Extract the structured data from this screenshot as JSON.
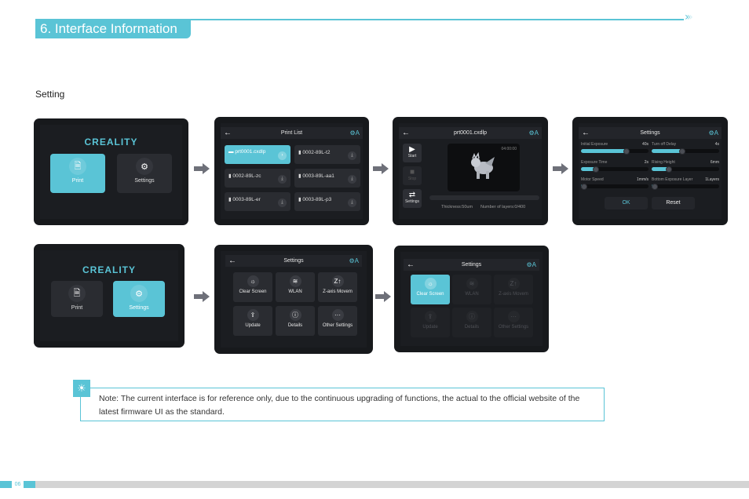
{
  "header": {
    "title": "6. Interface Information",
    "chevrons": [
      "›",
      "›",
      "›"
    ]
  },
  "section_label": "Setting",
  "brand": "CREALITY",
  "home_screen_print": {
    "buttons": [
      {
        "label": "Print",
        "icon": "file-icon",
        "glyph": "🗎",
        "active": true
      },
      {
        "label": "Settings",
        "icon": "gear-icon",
        "glyph": "⚙",
        "active": false
      }
    ]
  },
  "print_list": {
    "title": "Print List",
    "back_glyph": "←",
    "lang_glyph": "⚙A",
    "files": [
      {
        "name": "prt0001.cxdlp",
        "action": "›",
        "active": true
      },
      {
        "name": "0002-89L-t2",
        "action": "⤓",
        "active": false
      },
      {
        "name": "0002-89L-zc",
        "action": "⤓",
        "active": false
      },
      {
        "name": "0003-89L-aa1",
        "action": "⤓",
        "active": false
      },
      {
        "name": "0003-89L-er",
        "action": "⤓",
        "active": false
      },
      {
        "name": "0003-89L-p3",
        "action": "⤓",
        "active": false
      }
    ],
    "folder_glyph": "▬",
    "usb_glyph": "▮"
  },
  "print_detail": {
    "title": "prt0001.cxdlp",
    "time": "04:00:00",
    "buttons": [
      {
        "label": "Start",
        "glyph": "▶",
        "dim": false
      },
      {
        "label": "Stop",
        "glyph": "■",
        "dim": true
      },
      {
        "label": "Settings",
        "glyph": "⇄",
        "dim": false
      }
    ],
    "thickness": "Thickness:50um",
    "layers": "Number of layers:0/400",
    "progress": 0
  },
  "print_settings": {
    "title": "Settings",
    "sliders": [
      {
        "label": "Initial Exposure",
        "value": "40s",
        "fraction": 0.68
      },
      {
        "label": "Turn off Delay",
        "value": "4s",
        "fraction": 0.45
      },
      {
        "label": "Exposure Time",
        "value": "2s",
        "fraction": 0.22
      },
      {
        "label": "Rising Height",
        "value": "6mm",
        "fraction": 0.25
      },
      {
        "label": "Motor Speed",
        "value": "1mm/s",
        "fraction": 0.05
      },
      {
        "label": "Bottom Exposure Layer",
        "value": "1Layers",
        "fraction": 0.05
      }
    ],
    "ok_label": "OK",
    "reset_label": "Reset"
  },
  "home_screen_settings": {
    "buttons": [
      {
        "label": "Print",
        "glyph": "🗎",
        "active": false
      },
      {
        "label": "Settings",
        "glyph": "⚙",
        "active": true
      }
    ]
  },
  "settings_menu": {
    "title": "Settings",
    "tiles": [
      {
        "label": "Clear Screen",
        "glyph": "☼"
      },
      {
        "label": "WLAN",
        "glyph": "≋"
      },
      {
        "label": "Z-axis Movem",
        "glyph": "Z↑"
      },
      {
        "label": "Update",
        "glyph": "⇪"
      },
      {
        "label": "Details",
        "glyph": "ⓘ"
      },
      {
        "label": "Other Settings",
        "glyph": "···"
      }
    ]
  },
  "settings_menu_selected": {
    "title": "Settings",
    "selected": "Clear Screen"
  },
  "note": {
    "icon_glyph": "☀",
    "text": "Note: The current interface is for reference only, due to the continuous upgrading of functions, the actual to the official website of the latest firmware UI as the standard."
  },
  "footer": {
    "page_number": "06"
  }
}
